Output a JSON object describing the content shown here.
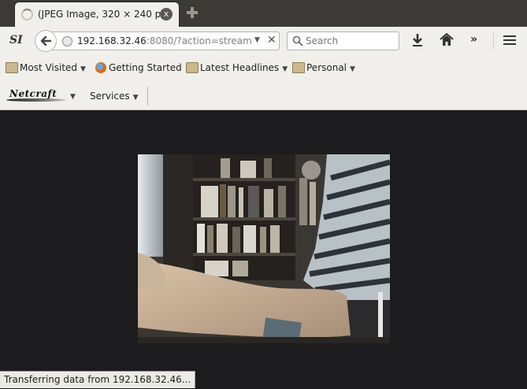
{
  "tab": {
    "title": "(JPEG Image, 320 × 240 p...",
    "close_label": "x"
  },
  "navbar": {
    "site_label": "SI",
    "url_host": "192.168.32.46",
    "url_rest": ":8080/?action=stream",
    "url_dropdown": "▼",
    "url_clear": "✕",
    "search_placeholder": "Search",
    "overflow_label": "»"
  },
  "bookmarks": [
    {
      "label": "Most Visited",
      "icon": "folder-icon",
      "caret": "▼"
    },
    {
      "label": "Getting Started",
      "icon": "firefox-icon",
      "caret": ""
    },
    {
      "label": "Latest Headlines",
      "icon": "rss-feed-icon",
      "caret": "▼"
    },
    {
      "label": "Personal",
      "icon": "folder-icon",
      "caret": "▼"
    }
  ],
  "addonbar": {
    "netcraft_label": "Netcraft",
    "netcraft_caret": "▼",
    "services_label": "Services",
    "services_caret": "▼"
  },
  "image": {
    "description_icon": "webcam-stream-image"
  },
  "status": {
    "text": "Transferring data from 192.168.32.46..."
  },
  "colors": {
    "chrome": "#f0efeb",
    "tabbar": "#3b3a36",
    "content_bg": "#1c1c1e"
  }
}
